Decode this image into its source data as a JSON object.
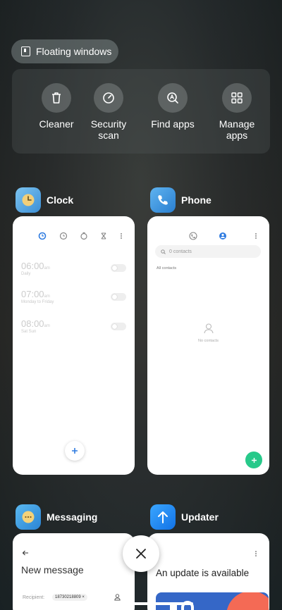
{
  "floating_windows": {
    "label": "Floating windows"
  },
  "tools": [
    {
      "label": "Cleaner",
      "icon": "trash-icon"
    },
    {
      "label": "Security scan",
      "icon": "gauge-icon"
    },
    {
      "label": "Find apps",
      "icon": "find-apps-icon"
    },
    {
      "label": "Manage apps",
      "icon": "grid-icon"
    }
  ],
  "apps": {
    "clock": {
      "name": "Clock",
      "color": "#5aa9e6",
      "alarms": [
        {
          "time": "06:00",
          "ampm": "am",
          "repeat": "Daily"
        },
        {
          "time": "07:00",
          "ampm": "am",
          "repeat": "Monday to Friday"
        },
        {
          "time": "08:00",
          "ampm": "am",
          "repeat": "Sat Sun"
        }
      ]
    },
    "phone": {
      "name": "Phone",
      "color": "#3a8fd8",
      "search_placeholder": "0 contacts",
      "section": "All contacts",
      "empty": "No contacts"
    },
    "messaging": {
      "name": "Messaging",
      "color": "#3a9ad9",
      "title": "New message",
      "recipient_label": "Recipient:",
      "recipient_value": "18730218809"
    },
    "updater": {
      "name": "Updater",
      "color": "#1e90ff",
      "headline": "An update is available"
    }
  }
}
